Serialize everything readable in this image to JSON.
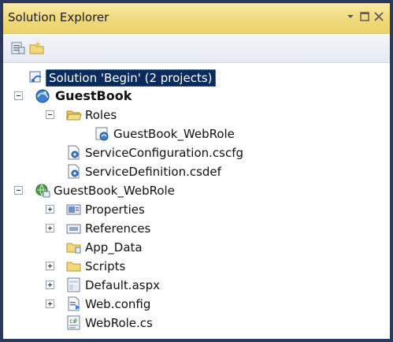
{
  "panel": {
    "title": "Solution Explorer"
  },
  "toolbar": {
    "buttons": [
      {
        "icon": "properties-icon"
      },
      {
        "icon": "new-folder-icon"
      }
    ]
  },
  "tree": [
    {
      "label": "Solution 'Begin' (2 projects)",
      "icon": "solution-icon",
      "selected": true
    },
    {
      "label": "GuestBook",
      "icon": "cloud-project-icon",
      "bold": true,
      "expanded": true
    },
    {
      "label": "Roles",
      "icon": "folder-open-icon",
      "expanded": true
    },
    {
      "label": "GuestBook_WebRole",
      "icon": "web-role-icon"
    },
    {
      "label": "ServiceConfiguration.cscfg",
      "icon": "config-file-icon"
    },
    {
      "label": "ServiceDefinition.csdef",
      "icon": "config-file-icon"
    },
    {
      "label": "GuestBook_WebRole",
      "icon": "web-project-icon",
      "expanded": true
    },
    {
      "label": "Properties",
      "icon": "properties-folder-icon",
      "expanded": false
    },
    {
      "label": "References",
      "icon": "references-folder-icon",
      "expanded": false
    },
    {
      "label": "App_Data",
      "icon": "folder-icon"
    },
    {
      "label": "Scripts",
      "icon": "folder-icon",
      "expanded": false
    },
    {
      "label": "Default.aspx",
      "icon": "aspx-file-icon",
      "expanded": false
    },
    {
      "label": "Web.config",
      "icon": "config-file-icon",
      "expanded": false
    },
    {
      "label": "WebRole.cs",
      "icon": "csharp-file-icon"
    }
  ]
}
